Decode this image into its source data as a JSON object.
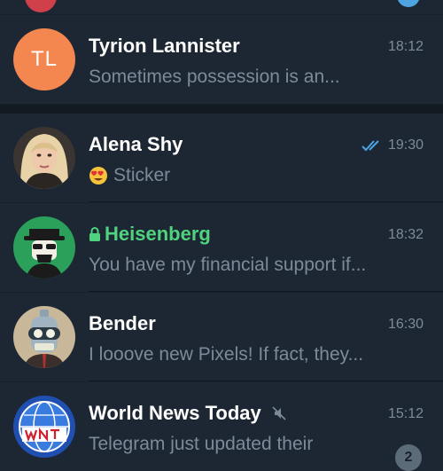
{
  "chats": [
    {
      "name": "Tyrion Lannister",
      "initials": "TL",
      "time": "18:12",
      "preview": "Sometimes possession is an..."
    },
    {
      "name": "Alena Shy",
      "time": "19:30",
      "preview": "Sticker",
      "preview_emoji": "heart-eyes-emoji",
      "read_status": "double-check-icon"
    },
    {
      "name": "Heisenberg",
      "time": "18:32",
      "preview": "You have my financial support if...",
      "secret": true
    },
    {
      "name": "Bender",
      "time": "16:30",
      "preview": "I looove new Pixels! If fact, they..."
    },
    {
      "name": "World News Today",
      "time": "15:12",
      "preview": "Telegram just updated their",
      "muted": true,
      "unread": "2"
    }
  ],
  "colors": {
    "background": "#17212b",
    "row": "#1d2733",
    "secret_name": "#4fd37e",
    "accent": "#4ea4e0",
    "muted_text": "#7d8b99"
  }
}
